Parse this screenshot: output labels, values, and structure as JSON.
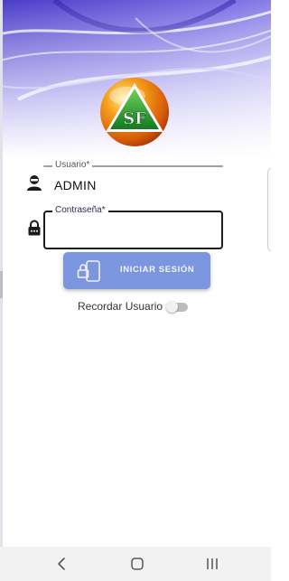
{
  "logo": {
    "text": "SF"
  },
  "username": {
    "label": "Usuario*",
    "value": "ADMIN"
  },
  "password": {
    "label": "Contraseña*",
    "value": ""
  },
  "login_button": {
    "label": "INICIAR SESIÓN"
  },
  "remember_user": {
    "label": "Recordar Usuario",
    "checked": false
  },
  "colors": {
    "accent_button": "#7b96de",
    "logo_orange": "#e07a10",
    "logo_green": "#1f9a2e",
    "hero_purple": "#5a4fd0"
  },
  "icons": {
    "username": "person-icon",
    "password": "lock-icon",
    "button": "phone-lock-icon",
    "nav_back": "back-chevron-icon",
    "nav_home": "home-icon",
    "nav_recents": "recents-icon"
  }
}
